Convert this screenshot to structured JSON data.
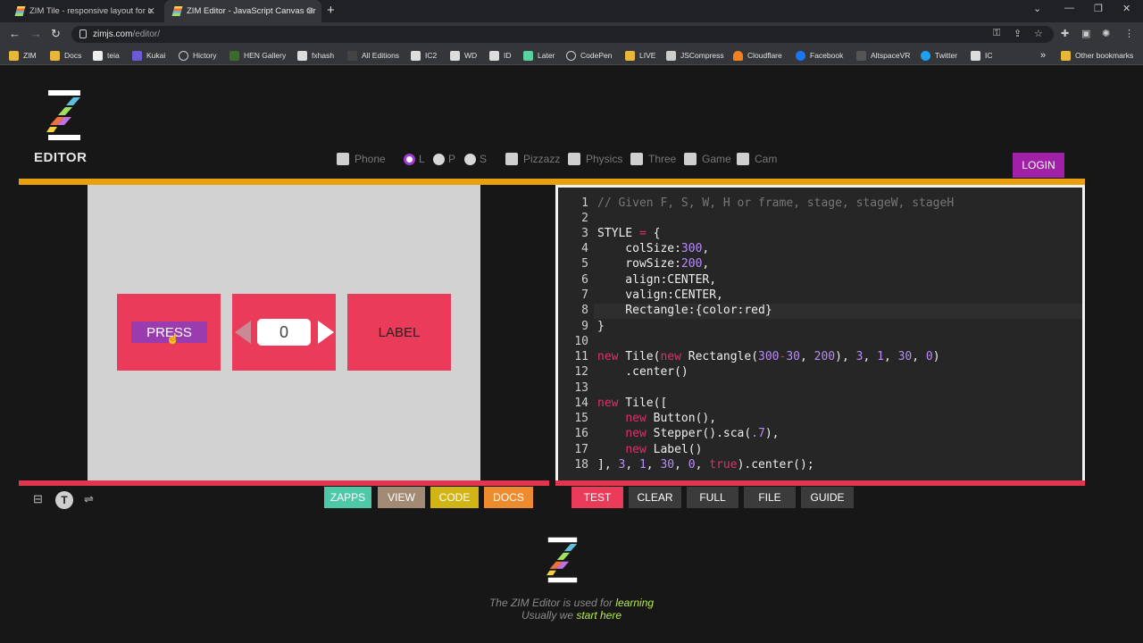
{
  "browser": {
    "tabs": [
      {
        "title": "ZIM Tile - responsive layout for c",
        "active": false
      },
      {
        "title": "ZIM Editor - JavaScript Canvas Or",
        "active": true
      }
    ],
    "url_host": "zimjs.com",
    "url_path": "/editor/",
    "bookmarks": [
      "ZIM",
      "Docs",
      "teia",
      "Kukai",
      "Hictory",
      "HEN Gallery",
      "fxhash",
      "All Editions",
      "IC2",
      "WD",
      "ID",
      "Later",
      "CodePen",
      "LIVE",
      "JSCompress",
      "Cloudflare",
      "Facebook",
      "AltspaceVR",
      "Twitter",
      "IC"
    ],
    "other_bookmarks": "Other bookmarks",
    "more_glyph": "»"
  },
  "editor": {
    "logo_text": "EDITOR",
    "options": {
      "phone": "Phone",
      "l": "L",
      "p": "P",
      "s": "S",
      "pizzazz": "Pizzazz",
      "physics": "Physics",
      "three": "Three",
      "game": "Game",
      "cam": "Cam"
    },
    "login": "LOGIN"
  },
  "stage": {
    "button_label": "PRESS",
    "stepper_value": "0",
    "label_text": "LABEL"
  },
  "code": {
    "line_numbers": [
      "1",
      "2",
      "3",
      "4",
      "5",
      "6",
      "7",
      "8",
      "9",
      "10",
      "11",
      "12",
      "13",
      "14",
      "15",
      "16",
      "17",
      "18"
    ],
    "comment": "// Given F, S, W, H or frame, stage, stageW, stageH"
  },
  "buttons": {
    "zapps": "ZAPPS",
    "view": "VIEW",
    "code": "CODE",
    "docs": "DOCS",
    "test": "TEST",
    "clear": "CLEAR",
    "full": "FULL",
    "file": "FILE",
    "guide": "GUIDE"
  },
  "footer": {
    "line1_prefix": "The ZIM Editor is used for ",
    "line1_link": "learning",
    "line2_prefix": "Usually we ",
    "line2_link": "start here"
  },
  "colors": {
    "accent_yellow": "#e8a10d",
    "accent_red": "#e0364f",
    "tile_red": "#ea3b5a",
    "button_purple": "#9b3bb0",
    "login_purple": "#a020a8",
    "zapps": "#4fc8a8",
    "view": "#a28a74",
    "code_btn": "#d1b416",
    "docs": "#ee8b2f",
    "test": "#ea3b5a",
    "dark_btn": "#3b3b3b"
  }
}
